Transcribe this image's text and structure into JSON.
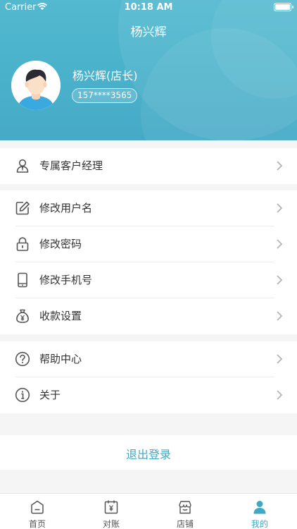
{
  "status_bar": {
    "carrier": "Carrier",
    "time": "10:18 AM"
  },
  "nav": {
    "title": "杨兴辉"
  },
  "profile": {
    "name": "杨兴辉(店长)",
    "phone": "157****3565"
  },
  "menu_groups": [
    {
      "items": [
        {
          "icon": "person-icon",
          "label": "专属客户经理"
        }
      ]
    },
    {
      "items": [
        {
          "icon": "edit-icon",
          "label": "修改用户名"
        },
        {
          "icon": "lock-icon",
          "label": "修改密码"
        },
        {
          "icon": "phone-icon",
          "label": "修改手机号"
        },
        {
          "icon": "money-bag-icon",
          "label": "收款设置"
        }
      ]
    },
    {
      "items": [
        {
          "icon": "help-icon",
          "label": "帮助中心"
        },
        {
          "icon": "info-icon",
          "label": "关于"
        }
      ]
    }
  ],
  "logout": {
    "label": "退出登录"
  },
  "tabbar": {
    "tabs": [
      {
        "label": "首页",
        "icon": "home-icon",
        "active": false
      },
      {
        "label": "对账",
        "icon": "calendar-yen-icon",
        "active": false
      },
      {
        "label": "店铺",
        "icon": "store-icon",
        "active": false
      },
      {
        "label": "我的",
        "icon": "user-icon",
        "active": true
      }
    ]
  },
  "colors": {
    "accent": "#3fa9c5",
    "header": "#4ab1cb",
    "text": "#333333",
    "icon": "#555555"
  }
}
